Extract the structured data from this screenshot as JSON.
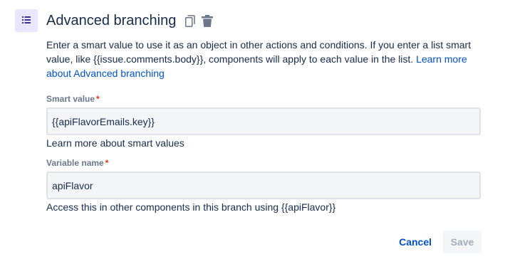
{
  "header": {
    "icon": "list-icon",
    "title": "Advanced branching",
    "copy_icon": "copy-icon",
    "delete_icon": "trash-icon"
  },
  "description": {
    "text": "Enter a smart value to use it as an object in other actions and conditions. If you enter a list smart value, like {{issue.comments.body}}, components will apply to each value in the list. ",
    "link": "Learn more about Advanced branching"
  },
  "smart_value": {
    "label": "Smart value",
    "required_mark": "*",
    "value": "{{apiFlavorEmails.key}}",
    "help_link": "Learn more about smart values"
  },
  "variable_name": {
    "label": "Variable name",
    "required_mark": "*",
    "value": "apiFlavor",
    "helper": "Access this in other components in this branch using {{apiFlavor}}"
  },
  "footer": {
    "cancel_label": "Cancel",
    "save_label": "Save"
  },
  "colors": {
    "accent": "#0052cc",
    "icon_bg": "#eae6ff",
    "required": "#de350b"
  }
}
